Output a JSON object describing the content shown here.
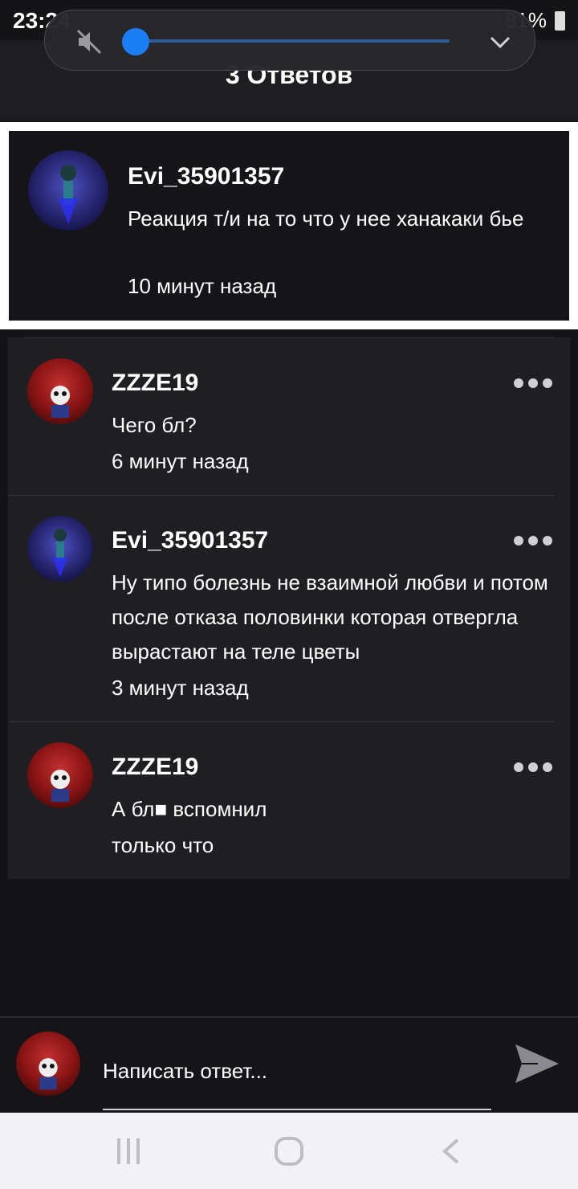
{
  "status_bar": {
    "time": "23:24",
    "battery": "81%"
  },
  "header": {
    "title": "3 Ответов"
  },
  "volume": {
    "level": 0.0
  },
  "original_comment": {
    "author": "Evi_35901357",
    "text": "Реакция т/и на то что у нее ханакаки бье",
    "time": "10 минут назад"
  },
  "replies": [
    {
      "author": "ZZZE19",
      "text": "Чего бл?",
      "time": "6 минут назад"
    },
    {
      "author": "Evi_35901357",
      "text": "Ну типо болезнь не взаимной любви и потом после отказа половинки которая отвергла вырастают на теле цветы",
      "time": "3 минут назад"
    },
    {
      "author": "ZZZE19",
      "text": "А бл■ вспомнил",
      "time": "только что"
    }
  ],
  "compose": {
    "placeholder": "Написать ответ..."
  },
  "colors": {
    "accent": "#1a7ff5",
    "background": "#141316",
    "card": "#1f1e22"
  },
  "icons": {
    "mute": "volume-mute-icon",
    "collapse": "chevron-down-icon",
    "more": "more-horizontal-icon",
    "send": "send-icon",
    "recent": "recent-apps-icon",
    "home": "home-icon",
    "back": "back-icon"
  }
}
